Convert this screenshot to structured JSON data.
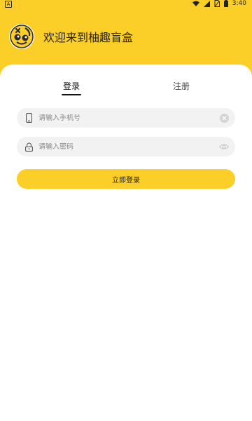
{
  "status_bar": {
    "app_indicator": "A",
    "time": "3:40"
  },
  "header": {
    "app_title": "欢迎来到柚趣盲盒"
  },
  "tabs": [
    {
      "label": "登录",
      "active": true
    },
    {
      "label": "注册",
      "active": false
    }
  ],
  "form": {
    "phone_placeholder": "请输入手机号",
    "phone_value": "",
    "password_placeholder": "请输入密码",
    "password_value": "",
    "submit_label": "立即登录"
  },
  "icons": {
    "phone": "phone-icon",
    "clear": "clear-icon",
    "lock": "lock-icon",
    "eye": "eye-icon",
    "logo": "app-logo-icon"
  },
  "colors": {
    "brand_yellow": "#FCCE28",
    "field_bg": "#F2F2F2",
    "text_dark": "#222222",
    "placeholder": "#8A8A8A"
  }
}
